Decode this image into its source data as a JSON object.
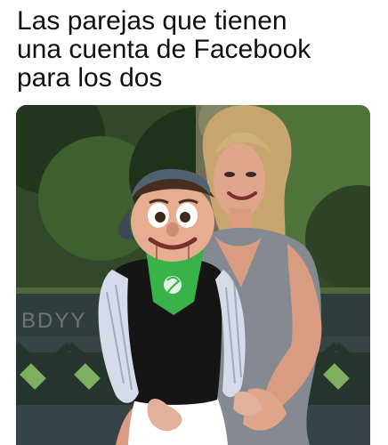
{
  "meme": {
    "caption_lines": [
      "Las parejas que tienen",
      "una cuenta de Facebook",
      "para los dos"
    ],
    "bench_watermark": "BDYY",
    "colors": {
      "background": "#ffffff",
      "caption_text": "#111111",
      "foliage_dark": "#22371d",
      "foliage_mid": "#43622f",
      "bench": "#2f3d3f",
      "dress": "#858a92",
      "scarf": "#39b24a",
      "vest": "#151515",
      "cap": "#50616f"
    }
  }
}
